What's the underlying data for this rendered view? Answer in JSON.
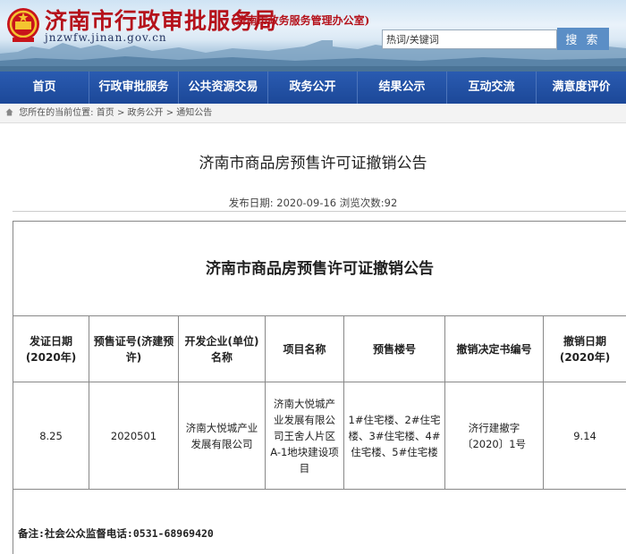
{
  "header": {
    "title": "济南市行政审批服务局",
    "subtitle": "(济南市政务服务管理办公室)",
    "url": "jnzwfw.jinan.gov.cn",
    "search_placeholder": "热词/关键词",
    "search_button": "搜 索"
  },
  "nav": {
    "items": [
      "首页",
      "行政审批服务",
      "公共资源交易",
      "政务公开",
      "结果公示",
      "互动交流",
      "满意度评价"
    ]
  },
  "breadcrumb": {
    "prefix": "您所在的当前位置:",
    "home": "首页",
    "sep1": ">",
    "section": "政务公开",
    "sep2": ">",
    "current": "通知公告"
  },
  "article": {
    "title": "济南市商品房预售许可证撤销公告",
    "meta": "发布日期: 2020-09-16 浏览次数:92"
  },
  "table": {
    "title": "济南市商品房预售许可证撤销公告",
    "headers": [
      "发证日期(2020年)",
      "预售证号(济建预许)",
      "开发企业(单位)名称",
      "项目名称",
      "预售楼号",
      "撤销决定书编号",
      "撤销日期(2020年)"
    ],
    "rows": [
      [
        "8.25",
        "2020501",
        "济南大悦城产业发展有限公司",
        "济南大悦城产业发展有限公司王舍人片区A-1地块建设项目",
        "1#住宅楼、2#住宅楼、3#住宅楼、4#住宅楼、5#住宅楼",
        "济行建撤字〔2020〕1号",
        "9.14"
      ]
    ]
  },
  "note": "备注:社会公众监督电话:0531-68969420",
  "colors": {
    "nav_bg": "#1c4898",
    "title_red": "#b5121b",
    "search_button": "#5b8ec6"
  }
}
